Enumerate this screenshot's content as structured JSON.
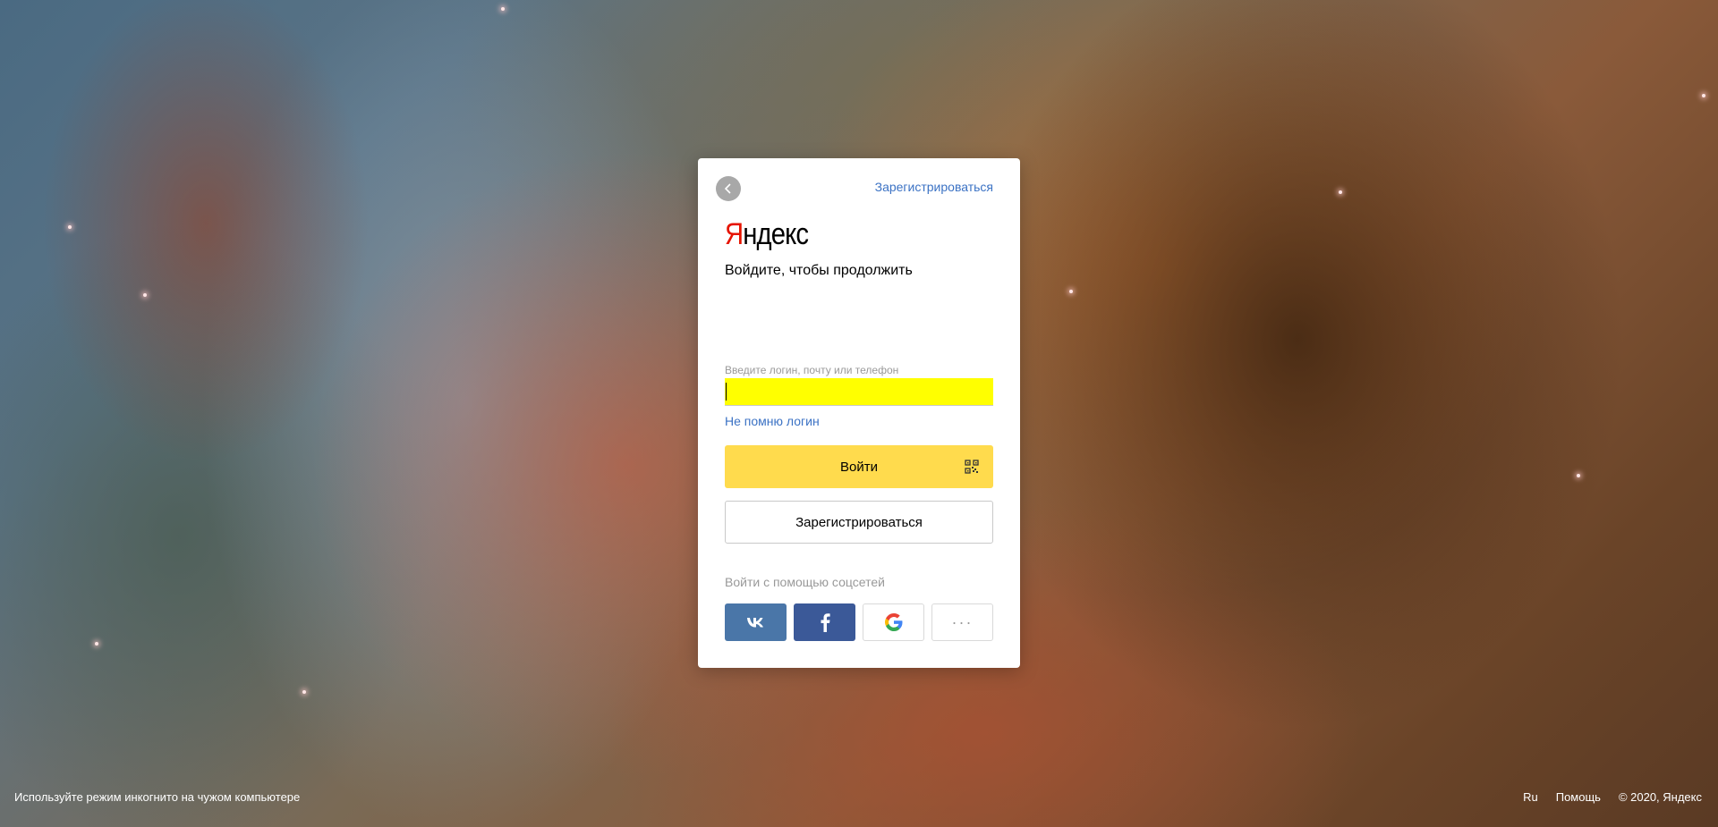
{
  "header": {
    "back_icon": "chevron-left-icon",
    "register_link": "Зарегистрироваться"
  },
  "logo": {
    "first_letter": "Я",
    "rest": "ндекс"
  },
  "subtitle": "Войдите, чтобы продолжить",
  "login": {
    "label": "Введите логин, почту или телефон",
    "value": "",
    "forgot_link": "Не помню логин",
    "submit_label": "Войти",
    "qr_icon": "qr-code-icon"
  },
  "register_button": "Зарегистрироваться",
  "social": {
    "label": "Войти с помощью соцсетей",
    "providers": [
      {
        "name": "vk",
        "icon": "vk-icon",
        "color": "#4a76a8"
      },
      {
        "name": "facebook",
        "icon": "facebook-icon",
        "color": "#3b5998"
      },
      {
        "name": "google",
        "icon": "google-icon",
        "color": "#ffffff"
      },
      {
        "name": "more",
        "icon": "more-dots-icon",
        "label": "···"
      }
    ]
  },
  "footer": {
    "incognito_hint": "Используйте режим инкогнито на чужом компьютере",
    "language": "Ru",
    "help": "Помощь",
    "copyright": "© 2020, Яндекс"
  },
  "colors": {
    "accent_yellow": "#ffdb4d",
    "link_blue": "#3b72c4",
    "logo_red": "#e61400",
    "autofill_yellow": "#ffff00"
  }
}
